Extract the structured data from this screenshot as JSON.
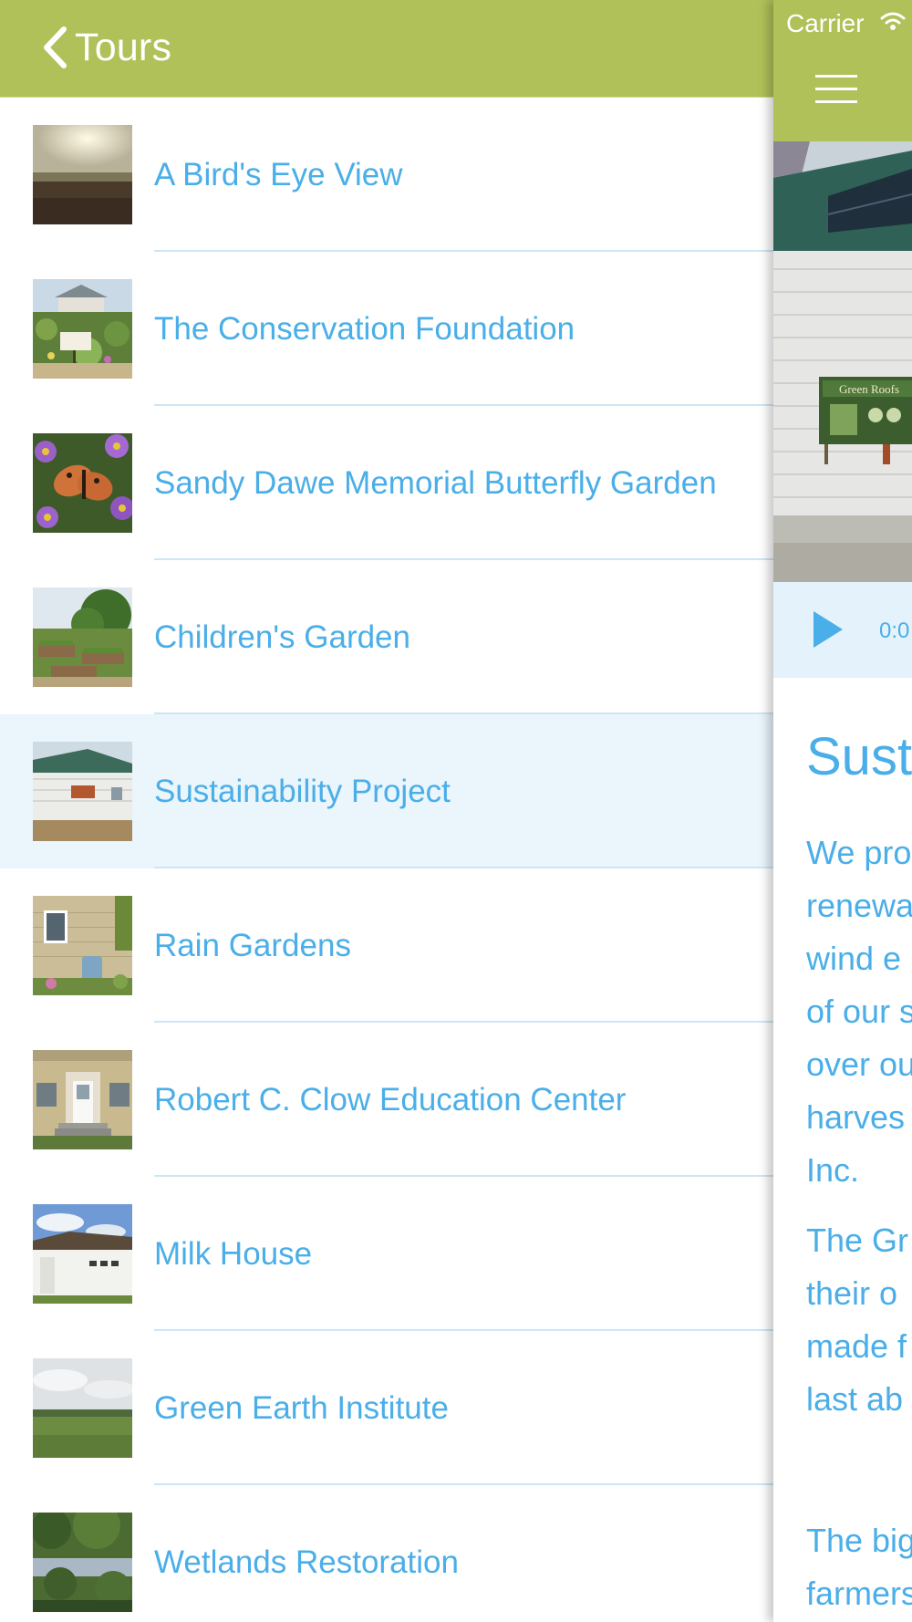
{
  "nav": {
    "back_label": "Tours"
  },
  "tours": [
    {
      "title": "A Bird's Eye View"
    },
    {
      "title": "The Conservation Foundation"
    },
    {
      "title": "Sandy Dawe Memorial Butterfly Garden"
    },
    {
      "title": "Children's Garden"
    },
    {
      "title": "Sustainability Project",
      "selected": true
    },
    {
      "title": "Rain Gardens"
    },
    {
      "title": "Robert C. Clow Education Center"
    },
    {
      "title": "Milk House"
    },
    {
      "title": "Green Earth Institute"
    },
    {
      "title": "Wetlands Restoration"
    }
  ],
  "status_bar": {
    "carrier": "Carrier",
    "wifi_icon": "wifi-icon"
  },
  "detail": {
    "menu_icon": "hamburger-menu-icon",
    "photo_sign_text": "Green Roofs",
    "audio": {
      "play_icon": "play-icon",
      "time": "0:0"
    },
    "title": "Susta",
    "paragraph_1_lines": [
      "We pro",
      "renewa",
      "wind e",
      "of our s",
      "over ou",
      "harves",
      "Inc."
    ],
    "paragraph_2_lines": [
      "The Gr",
      "their o",
      "made f",
      "last ab"
    ],
    "paragraph_3_lines": [
      "The big",
      "farmers"
    ]
  },
  "colors": {
    "header_green": "#afc158",
    "link_blue": "#4aaee8",
    "separator": "#cde6f5",
    "selected_row": "#eaf5fc",
    "audio_bg": "#e4f2fb"
  }
}
